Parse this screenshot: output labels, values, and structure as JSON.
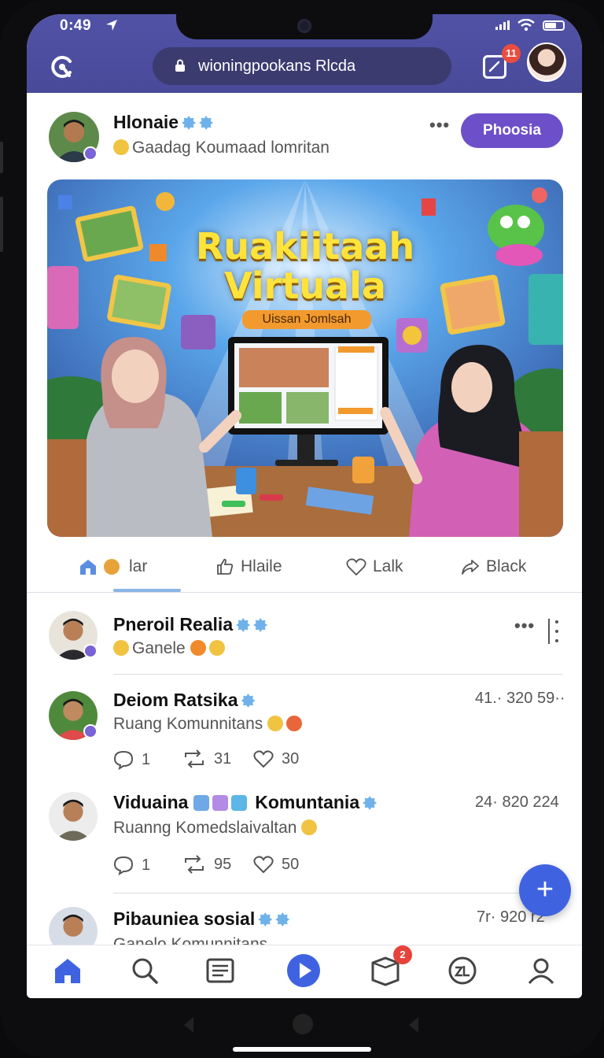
{
  "status": {
    "time": "0:49"
  },
  "header": {
    "url": "wioningpookans Rlcda",
    "tab_count": "11"
  },
  "post": {
    "author": "Hlonaie",
    "subtitle": "Gaadag Koumaad lomritan",
    "follow_label": "Phoosia",
    "banner": {
      "title_line1": "Ruakiitaah",
      "title_line2": "Virtuala",
      "ribbon": "Uissan Jomlsah"
    },
    "actions": [
      {
        "label": "lar",
        "icon": "home-emoji-icon"
      },
      {
        "label": "Hlaile",
        "icon": "thumbs-up-icon"
      },
      {
        "label": "Lalk",
        "icon": "heart-icon"
      },
      {
        "label": "Black",
        "icon": "share-icon"
      }
    ]
  },
  "feed": [
    {
      "name": "Pneroil Realia",
      "sub": "Ganele",
      "time": "",
      "stats": null
    },
    {
      "name": "Deiom Ratsika",
      "sub": "Ruang Komunnitans",
      "time": "41.· 320 59··",
      "stats": {
        "comments": "1",
        "reposts": "31",
        "likes": "30"
      }
    },
    {
      "name": "Viduaina",
      "name_suffix": "Komuntania",
      "sub": "Ruanng Komedslaivaltan",
      "time": "24· 820 224",
      "stats": {
        "comments": "1",
        "reposts": "95",
        "likes": "50"
      }
    },
    {
      "name": "Pibauniea sosial",
      "sub": "Ganelo Komunnitans",
      "time": "7r· 920 r2",
      "stats": null
    }
  ],
  "bottom_nav": {
    "items": [
      "home-icon",
      "search-icon",
      "feed-icon",
      "play-icon",
      "inbox-icon",
      "community-icon",
      "profile-icon"
    ],
    "inbox_badge": "2"
  },
  "colors": {
    "accent": "#6d4fc9",
    "header": "#4d4ea0",
    "fab": "#3f63e0"
  }
}
